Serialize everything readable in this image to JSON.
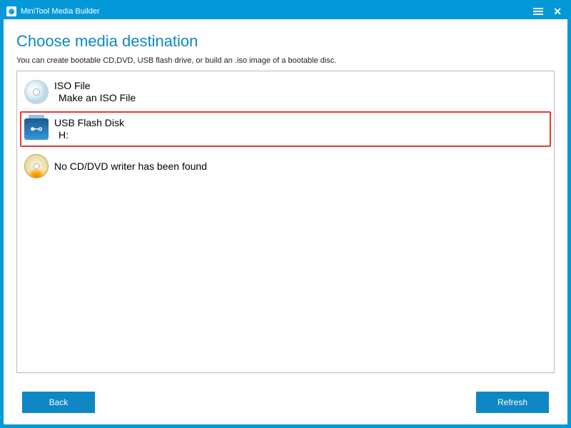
{
  "titlebar": {
    "title": "MiniTool Media Builder"
  },
  "page": {
    "heading": "Choose media destination",
    "description": "You can create bootable CD,DVD, USB flash drive, or build an .iso image of a bootable disc."
  },
  "options": {
    "iso": {
      "title": "ISO File",
      "subtitle": "Make an ISO File"
    },
    "usb": {
      "title": "USB Flash Disk",
      "subtitle": "H:"
    },
    "cd": {
      "text": "No CD/DVD writer has been found"
    }
  },
  "footer": {
    "back_label": "Back",
    "refresh_label": "Refresh"
  }
}
